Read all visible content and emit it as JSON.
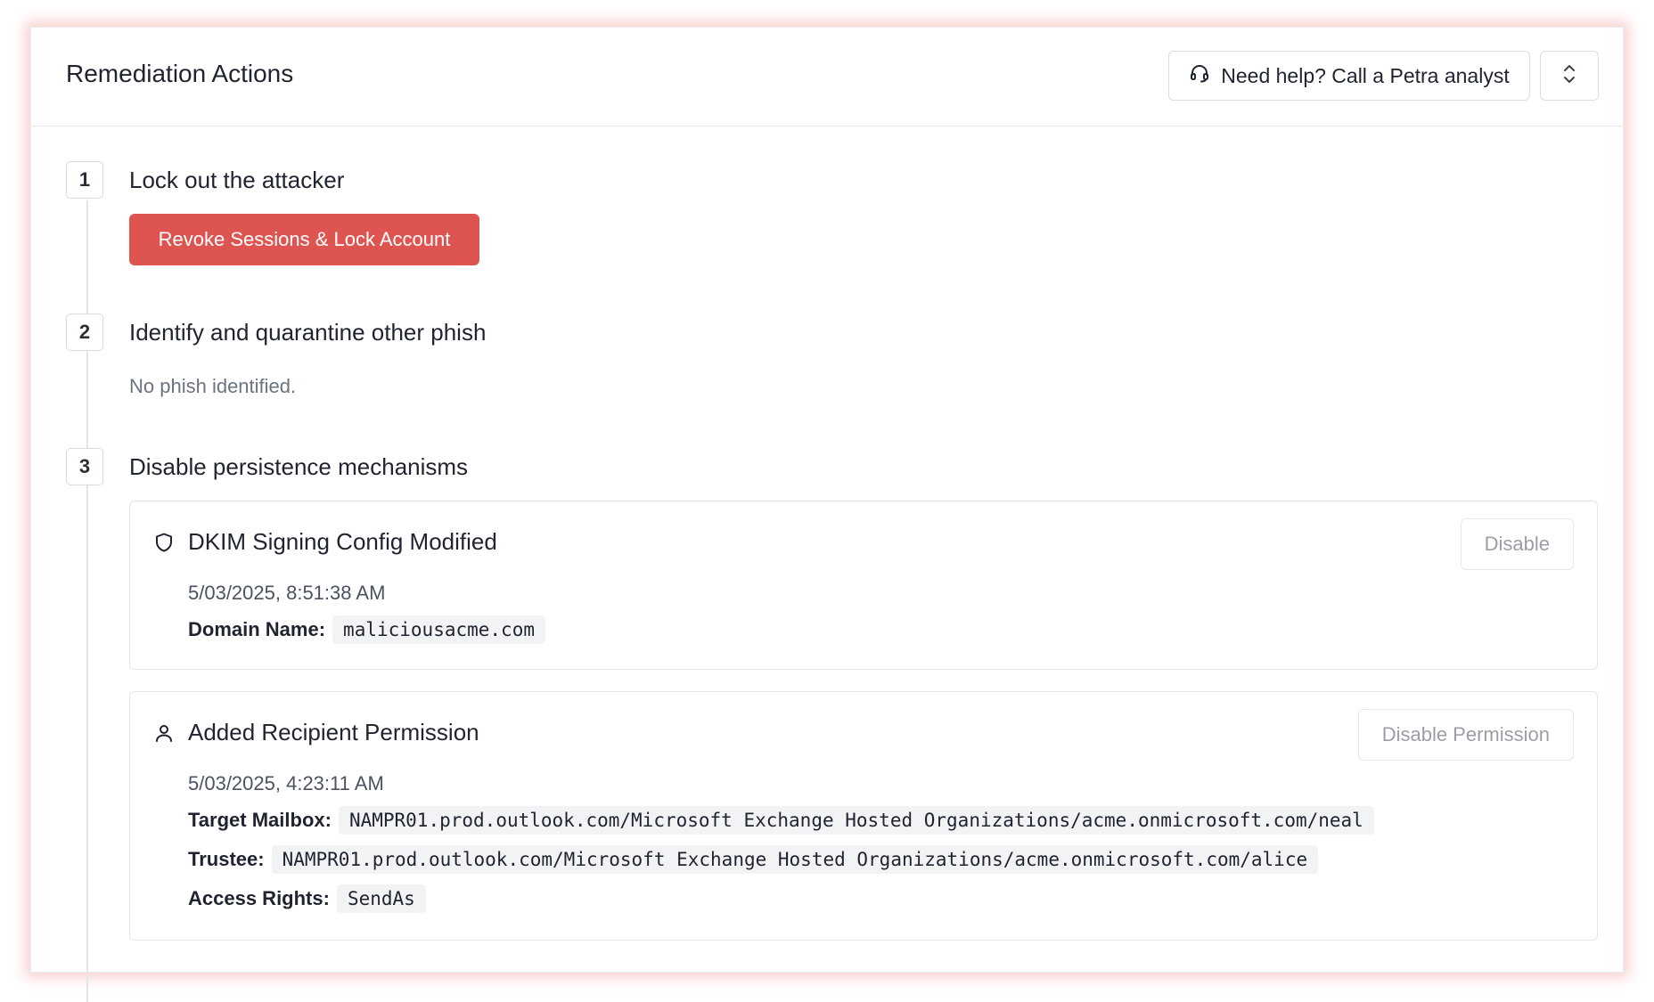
{
  "header": {
    "title": "Remediation Actions",
    "help_label": "Need help? Call a Petra analyst",
    "help_icon": "headset-icon",
    "expand_icon": "chevron-up-down-icon"
  },
  "colors": {
    "accent_red": "#dd5450",
    "shadow_glow": "#e85858"
  },
  "steps": [
    {
      "number": "1",
      "title": "Lock out the attacker",
      "action_label": "Revoke Sessions & Lock Account"
    },
    {
      "number": "2",
      "title": "Identify and quarantine other phish",
      "status_text": "No phish identified."
    },
    {
      "number": "3",
      "title": "Disable persistence mechanisms",
      "cards": [
        {
          "icon": "shield-icon",
          "title": "DKIM Signing Config Modified",
          "button_label": "Disable",
          "timestamp": "5/03/2025, 8:51:38 AM",
          "fields": [
            {
              "label": "Domain Name:",
              "value": "maliciousacme.com"
            }
          ]
        },
        {
          "icon": "user-icon",
          "title": "Added Recipient Permission",
          "button_label": "Disable Permission",
          "timestamp": "5/03/2025, 4:23:11 AM",
          "fields": [
            {
              "label": "Target Mailbox:",
              "value": "NAMPR01.prod.outlook.com/Microsoft Exchange Hosted Organizations/acme.onmicrosoft.com/neal"
            },
            {
              "label": "Trustee:",
              "value": "NAMPR01.prod.outlook.com/Microsoft Exchange Hosted Organizations/acme.onmicrosoft.com/alice"
            },
            {
              "label": "Access Rights:",
              "value": "SendAs"
            }
          ]
        }
      ]
    }
  ]
}
